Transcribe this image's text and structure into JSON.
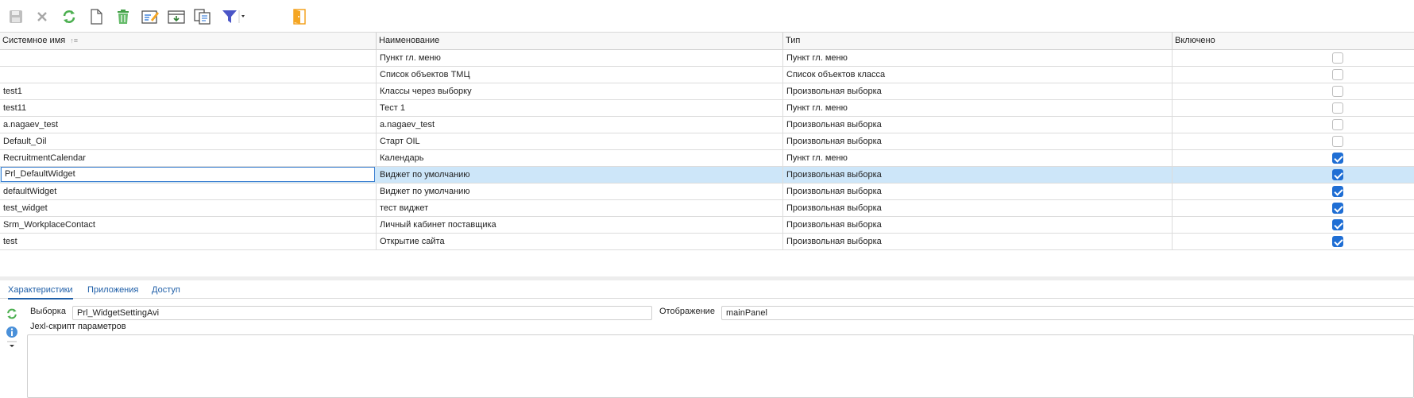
{
  "toolbar": {
    "buttons": [
      {
        "icon": "save-icon",
        "enabled": false
      },
      {
        "icon": "cancel-icon",
        "enabled": false
      },
      {
        "icon": "refresh-icon",
        "enabled": true
      },
      {
        "icon": "new-document-icon",
        "enabled": true
      },
      {
        "icon": "delete-icon",
        "enabled": true
      },
      {
        "icon": "edit-icon",
        "enabled": true
      },
      {
        "icon": "import-icon",
        "enabled": true
      },
      {
        "icon": "copy-icon",
        "enabled": true
      },
      {
        "icon": "filter-icon",
        "enabled": true
      },
      {
        "icon": "exit-icon",
        "enabled": true
      }
    ]
  },
  "grid": {
    "columns": [
      "Системное имя",
      "Наименование",
      "Тип",
      "Включено"
    ],
    "rows": [
      {
        "sysname": "",
        "name": "Пункт гл. меню",
        "type": "Пункт гл. меню",
        "enabled": false
      },
      {
        "sysname": "",
        "name": "Список объектов ТМЦ",
        "type": "Список объектов класса",
        "enabled": false
      },
      {
        "sysname": "test1",
        "name": "Классы через выборку",
        "type": "Произвольная выборка",
        "enabled": false
      },
      {
        "sysname": "test11",
        "name": "Тест 1",
        "type": "Пункт гл. меню",
        "enabled": false
      },
      {
        "sysname": "a.nagaev_test",
        "name": "a.nagaev_test",
        "type": "Произвольная выборка",
        "enabled": false
      },
      {
        "sysname": "Default_Oil",
        "name": "Старт OIL",
        "type": "Произвольная выборка",
        "enabled": false
      },
      {
        "sysname": "RecruitmentCalendar",
        "name": "Календарь",
        "type": "Пункт гл. меню",
        "enabled": true
      },
      {
        "sysname": "Prl_DefaultWidget",
        "name": "Виджет по умолчанию",
        "type": "Произвольная выборка",
        "enabled": true,
        "selected": true
      },
      {
        "sysname": "defaultWidget",
        "name": "Виджет по умолчанию",
        "type": "Произвольная выборка",
        "enabled": true
      },
      {
        "sysname": "test_widget",
        "name": "тест виджет",
        "type": "Произвольная выборка",
        "enabled": true
      },
      {
        "sysname": "Srm_WorkplaceContact",
        "name": "Личный кабинет поставщика",
        "type": "Произвольная выборка",
        "enabled": true
      },
      {
        "sysname": "test",
        "name": "Открытие сайта",
        "type": "Произвольная выборка",
        "enabled": true
      }
    ]
  },
  "tabs": [
    "Характеристики",
    "Приложения",
    "Доступ"
  ],
  "form": {
    "selection_label": "Выборка",
    "selection_value": "Prl_WidgetSettingAvi",
    "display_label": "Отображение",
    "display_value": "mainPanel",
    "script_label": "Jexl-скрипт параметров"
  },
  "colors": {
    "accent": "#1f6ed4",
    "selected_row": "#cde6f9"
  }
}
